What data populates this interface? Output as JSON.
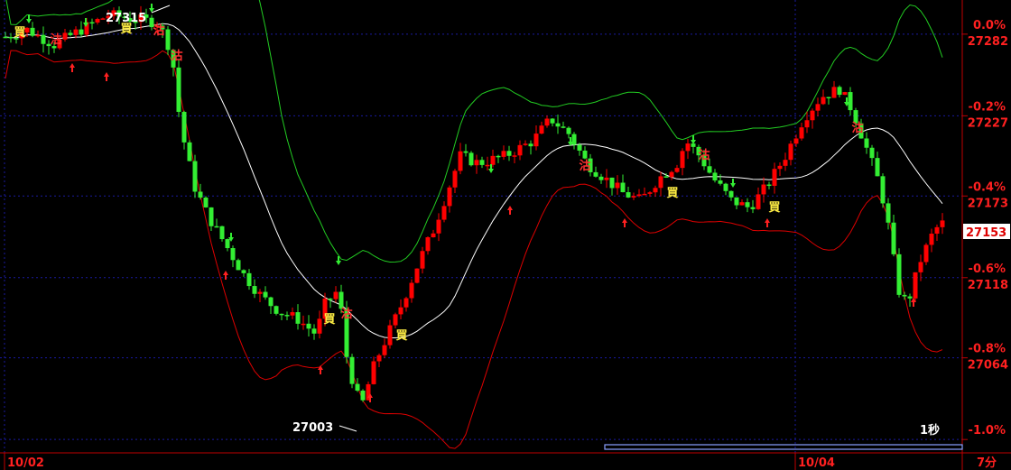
{
  "chart_data": {
    "type": "candlestick",
    "interval_label": "7分",
    "speed_label": "1秒",
    "last_price": "27153",
    "x_dates": [
      "10/02",
      "10/04"
    ],
    "y_ticks": [
      {
        "pct": "0.0%",
        "price": "27282",
        "value": 27282
      },
      {
        "pct": "-0.2%",
        "price": "27227",
        "value": 27227
      },
      {
        "pct": "-0.4%",
        "price": "27173",
        "value": 27173
      },
      {
        "pct": "-0.6%",
        "price": "27118",
        "value": 27118
      },
      {
        "pct": "-0.8%",
        "price": "27064",
        "value": 27064
      },
      {
        "pct": "-1.0%",
        "price": "",
        "value": 27009
      }
    ],
    "ylim": [
      27000,
      27305
    ],
    "high_marker": "27315",
    "low_marker": "27003",
    "signal_buy": "買",
    "signal_sell": "沽",
    "colors": {
      "up": "#ff0000",
      "down": "#33ee33",
      "mid_band": "#ffffff",
      "upper_band": "#22cc22",
      "lower_band": "#dd0000",
      "grid": "#1a1aa0",
      "axis": "#c00000",
      "tick_text": "#ff2020"
    }
  }
}
